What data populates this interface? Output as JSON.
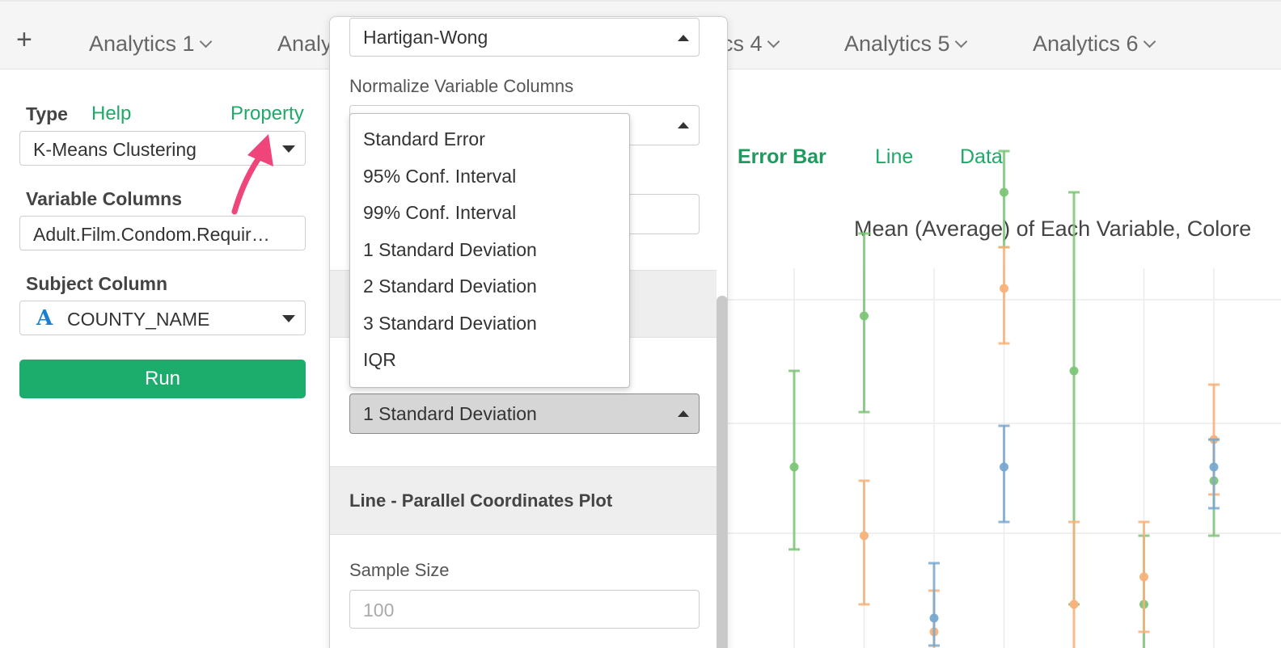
{
  "tabs": {
    "add_label": "+",
    "items": [
      {
        "label": "Analytics 1",
        "left": 110
      },
      {
        "label": "Analy",
        "left": 343
      },
      {
        "label": "cs 4",
        "left": 893
      },
      {
        "label": "Analytics 5",
        "left": 1044
      },
      {
        "label": "Analytics 6",
        "left": 1277
      }
    ]
  },
  "left_panel": {
    "type_label": "Type",
    "help_link": "Help",
    "property_link": "Property",
    "type_value": "K-Means Clustering",
    "variable_columns_label": "Variable Columns",
    "variable_columns_value": "Adult.Film.Condom.Requir…",
    "subject_column_label": "Subject Column",
    "subject_column_type_icon": "A",
    "subject_column_value": "COUNTY_NAME",
    "run_label": "Run"
  },
  "popover": {
    "algorithm_value": "Hartigan-Wong",
    "normalize_label": "Normalize Variable Columns",
    "error_bar_value": "1 Standard Deviation",
    "line_section_title": "Line - Parallel Coordinates Plot",
    "sample_size_label": "Sample Size",
    "sample_size_placeholder": "100"
  },
  "dropdown": {
    "options": [
      "Standard Error",
      "95% Conf. Interval",
      "99% Conf. Interval",
      "1 Standard Deviation",
      "2 Standard Deviation",
      "3 Standard Deviation",
      "IQR"
    ]
  },
  "chart_tabs": {
    "error_bar": "Error Bar",
    "line": "Line",
    "data": "Data"
  },
  "chart_title": "Mean (Average) of Each Variable, Colore",
  "colors": {
    "accent": "#1cac6c",
    "green_series": "#7cc576",
    "orange_series": "#f7b27a",
    "blue_series": "#78a9d2",
    "arrow": "#f0457a"
  },
  "chart_data": {
    "type": "scatter",
    "title": "Mean (Average) of Each Variable, Colore",
    "series": [
      {
        "color": "#7cc576",
        "points": [
          {
            "x": 1,
            "mean": 0.6,
            "lo": 0.3,
            "hi": 0.95
          },
          {
            "x": 2,
            "mean": 1.15,
            "lo": 0.8,
            "hi": 1.45
          },
          {
            "x": 4,
            "mean": 1.6,
            "lo": 1.4,
            "hi": 1.75
          },
          {
            "x": 5,
            "mean": 0.95,
            "lo": 0.1,
            "hi": 1.6
          },
          {
            "x": 6,
            "mean": 0.1,
            "lo": -0.1,
            "hi": 0.35
          },
          {
            "x": 7,
            "mean": 0.55,
            "lo": 0.35,
            "hi": 0.7
          }
        ]
      },
      {
        "color": "#f7b27a",
        "points": [
          {
            "x": 2,
            "mean": 0.35,
            "lo": 0.1,
            "hi": 0.55
          },
          {
            "x": 3,
            "mean": 0.0,
            "lo": -0.1,
            "hi": 0.15
          },
          {
            "x": 4,
            "mean": 1.25,
            "lo": 1.05,
            "hi": 1.4
          },
          {
            "x": 5,
            "mean": 0.1,
            "lo": -0.2,
            "hi": 0.4
          },
          {
            "x": 6,
            "mean": 0.2,
            "lo": 0.0,
            "hi": 0.4
          },
          {
            "x": 7,
            "mean": 0.7,
            "lo": 0.5,
            "hi": 0.9
          }
        ]
      },
      {
        "color": "#78a9d2",
        "points": [
          {
            "x": 3,
            "mean": 0.05,
            "lo": -0.05,
            "hi": 0.25
          },
          {
            "x": 4,
            "mean": 0.6,
            "lo": 0.4,
            "hi": 0.75
          },
          {
            "x": 7,
            "mean": 0.6,
            "lo": 0.45,
            "hi": 0.7
          }
        ]
      }
    ]
  }
}
